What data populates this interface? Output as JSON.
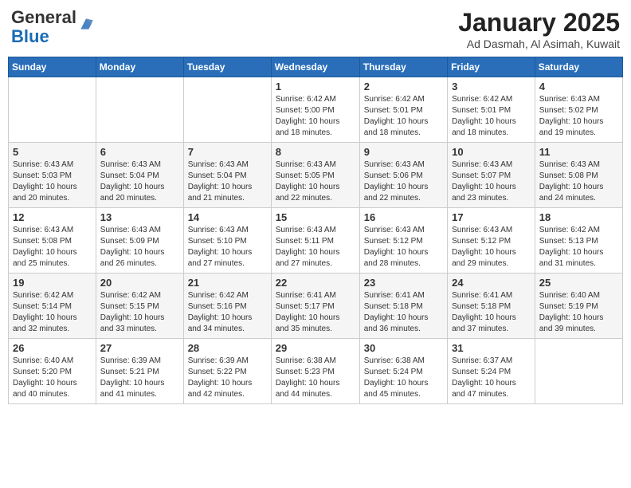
{
  "header": {
    "logo_general": "General",
    "logo_blue": "Blue",
    "month_title": "January 2025",
    "subtitle": "Ad Dasmah, Al Asimah, Kuwait"
  },
  "days_of_week": [
    "Sunday",
    "Monday",
    "Tuesday",
    "Wednesday",
    "Thursday",
    "Friday",
    "Saturday"
  ],
  "weeks": [
    [
      {
        "day": "",
        "info": ""
      },
      {
        "day": "",
        "info": ""
      },
      {
        "day": "",
        "info": ""
      },
      {
        "day": "1",
        "info": "Sunrise: 6:42 AM\nSunset: 5:00 PM\nDaylight: 10 hours\nand 18 minutes."
      },
      {
        "day": "2",
        "info": "Sunrise: 6:42 AM\nSunset: 5:01 PM\nDaylight: 10 hours\nand 18 minutes."
      },
      {
        "day": "3",
        "info": "Sunrise: 6:42 AM\nSunset: 5:01 PM\nDaylight: 10 hours\nand 18 minutes."
      },
      {
        "day": "4",
        "info": "Sunrise: 6:43 AM\nSunset: 5:02 PM\nDaylight: 10 hours\nand 19 minutes."
      }
    ],
    [
      {
        "day": "5",
        "info": "Sunrise: 6:43 AM\nSunset: 5:03 PM\nDaylight: 10 hours\nand 20 minutes."
      },
      {
        "day": "6",
        "info": "Sunrise: 6:43 AM\nSunset: 5:04 PM\nDaylight: 10 hours\nand 20 minutes."
      },
      {
        "day": "7",
        "info": "Sunrise: 6:43 AM\nSunset: 5:04 PM\nDaylight: 10 hours\nand 21 minutes."
      },
      {
        "day": "8",
        "info": "Sunrise: 6:43 AM\nSunset: 5:05 PM\nDaylight: 10 hours\nand 22 minutes."
      },
      {
        "day": "9",
        "info": "Sunrise: 6:43 AM\nSunset: 5:06 PM\nDaylight: 10 hours\nand 22 minutes."
      },
      {
        "day": "10",
        "info": "Sunrise: 6:43 AM\nSunset: 5:07 PM\nDaylight: 10 hours\nand 23 minutes."
      },
      {
        "day": "11",
        "info": "Sunrise: 6:43 AM\nSunset: 5:08 PM\nDaylight: 10 hours\nand 24 minutes."
      }
    ],
    [
      {
        "day": "12",
        "info": "Sunrise: 6:43 AM\nSunset: 5:08 PM\nDaylight: 10 hours\nand 25 minutes."
      },
      {
        "day": "13",
        "info": "Sunrise: 6:43 AM\nSunset: 5:09 PM\nDaylight: 10 hours\nand 26 minutes."
      },
      {
        "day": "14",
        "info": "Sunrise: 6:43 AM\nSunset: 5:10 PM\nDaylight: 10 hours\nand 27 minutes."
      },
      {
        "day": "15",
        "info": "Sunrise: 6:43 AM\nSunset: 5:11 PM\nDaylight: 10 hours\nand 27 minutes."
      },
      {
        "day": "16",
        "info": "Sunrise: 6:43 AM\nSunset: 5:12 PM\nDaylight: 10 hours\nand 28 minutes."
      },
      {
        "day": "17",
        "info": "Sunrise: 6:43 AM\nSunset: 5:12 PM\nDaylight: 10 hours\nand 29 minutes."
      },
      {
        "day": "18",
        "info": "Sunrise: 6:42 AM\nSunset: 5:13 PM\nDaylight: 10 hours\nand 31 minutes."
      }
    ],
    [
      {
        "day": "19",
        "info": "Sunrise: 6:42 AM\nSunset: 5:14 PM\nDaylight: 10 hours\nand 32 minutes."
      },
      {
        "day": "20",
        "info": "Sunrise: 6:42 AM\nSunset: 5:15 PM\nDaylight: 10 hours\nand 33 minutes."
      },
      {
        "day": "21",
        "info": "Sunrise: 6:42 AM\nSunset: 5:16 PM\nDaylight: 10 hours\nand 34 minutes."
      },
      {
        "day": "22",
        "info": "Sunrise: 6:41 AM\nSunset: 5:17 PM\nDaylight: 10 hours\nand 35 minutes."
      },
      {
        "day": "23",
        "info": "Sunrise: 6:41 AM\nSunset: 5:18 PM\nDaylight: 10 hours\nand 36 minutes."
      },
      {
        "day": "24",
        "info": "Sunrise: 6:41 AM\nSunset: 5:18 PM\nDaylight: 10 hours\nand 37 minutes."
      },
      {
        "day": "25",
        "info": "Sunrise: 6:40 AM\nSunset: 5:19 PM\nDaylight: 10 hours\nand 39 minutes."
      }
    ],
    [
      {
        "day": "26",
        "info": "Sunrise: 6:40 AM\nSunset: 5:20 PM\nDaylight: 10 hours\nand 40 minutes."
      },
      {
        "day": "27",
        "info": "Sunrise: 6:39 AM\nSunset: 5:21 PM\nDaylight: 10 hours\nand 41 minutes."
      },
      {
        "day": "28",
        "info": "Sunrise: 6:39 AM\nSunset: 5:22 PM\nDaylight: 10 hours\nand 42 minutes."
      },
      {
        "day": "29",
        "info": "Sunrise: 6:38 AM\nSunset: 5:23 PM\nDaylight: 10 hours\nand 44 minutes."
      },
      {
        "day": "30",
        "info": "Sunrise: 6:38 AM\nSunset: 5:24 PM\nDaylight: 10 hours\nand 45 minutes."
      },
      {
        "day": "31",
        "info": "Sunrise: 6:37 AM\nSunset: 5:24 PM\nDaylight: 10 hours\nand 47 minutes."
      },
      {
        "day": "",
        "info": ""
      }
    ]
  ]
}
